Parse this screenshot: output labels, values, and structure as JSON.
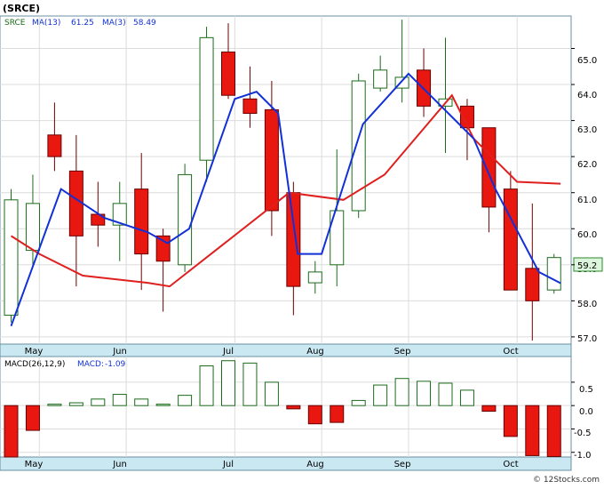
{
  "title": "(SRCE)",
  "copyright": "© 12Stocks.com",
  "colors": {
    "up_candle": "#1a6b1a",
    "down_candle": "#e8170f",
    "ma13": "#e01f1f",
    "ma3": "#1230d8",
    "axis_band": "#c9e8f2",
    "page_bg": "#ffffff",
    "last_price_box": "#2a8a2a"
  },
  "price_panel": {
    "legend": {
      "symbol": "SRCE",
      "ma13_label": "MA(13)",
      "ma13_value": "61.25",
      "ma3_label": "MA(3)",
      "ma3_value": "58.49"
    },
    "last_price": "59.2",
    "y_ticks": [
      "57.0",
      "58.0",
      "59.0",
      "60.0",
      "61.0",
      "62.0",
      "63.0",
      "64.0",
      "65.0"
    ]
  },
  "macd_panel": {
    "legend": {
      "label": "MACD(26,12,9)",
      "value_label": "MACD:",
      "value": "-1.09"
    },
    "y_ticks": [
      "0.5",
      "0.0",
      "-0.5",
      "-1.0"
    ]
  },
  "months": [
    "May",
    "Jun",
    "Jul",
    "Aug",
    "Sep",
    "Oct"
  ],
  "chart_data": [
    {
      "type": "candlestick",
      "title": "(SRCE)",
      "ylim": [
        56.8,
        65.9
      ],
      "y_ticks": [
        57,
        58,
        59,
        60,
        61,
        62,
        63,
        64,
        65
      ],
      "x_month_labels": [
        {
          "label": "May",
          "index": 1.3
        },
        {
          "label": "Jun",
          "index": 5.3
        },
        {
          "label": "Jul",
          "index": 10.3
        },
        {
          "label": "Aug",
          "index": 14.3
        },
        {
          "label": "Sep",
          "index": 18.3
        },
        {
          "label": "Oct",
          "index": 23.3
        }
      ],
      "candles": [
        {
          "o": 57.6,
          "h": 61.1,
          "l": 57.4,
          "c": 60.8
        },
        {
          "o": 59.4,
          "h": 61.5,
          "l": 59.0,
          "c": 60.7
        },
        {
          "o": 62.6,
          "h": 63.5,
          "l": 61.6,
          "c": 62.0
        },
        {
          "o": 61.6,
          "h": 62.6,
          "l": 58.4,
          "c": 59.8
        },
        {
          "o": 60.4,
          "h": 61.3,
          "l": 59.5,
          "c": 60.1
        },
        {
          "o": 60.1,
          "h": 61.3,
          "l": 59.1,
          "c": 60.7
        },
        {
          "o": 61.1,
          "h": 62.1,
          "l": 58.3,
          "c": 59.3
        },
        {
          "o": 59.8,
          "h": 60.0,
          "l": 57.7,
          "c": 59.1
        },
        {
          "o": 59.0,
          "h": 61.8,
          "l": 58.8,
          "c": 61.5
        },
        {
          "o": 61.9,
          "h": 65.6,
          "l": 61.3,
          "c": 65.3
        },
        {
          "o": 64.9,
          "h": 65.7,
          "l": 63.6,
          "c": 63.7
        },
        {
          "o": 63.6,
          "h": 64.5,
          "l": 62.8,
          "c": 63.2
        },
        {
          "o": 63.3,
          "h": 64.1,
          "l": 59.8,
          "c": 60.5
        },
        {
          "o": 61.0,
          "h": 61.3,
          "l": 57.6,
          "c": 58.4
        },
        {
          "o": 58.5,
          "h": 59.1,
          "l": 58.2,
          "c": 58.8
        },
        {
          "o": 59.0,
          "h": 62.2,
          "l": 58.4,
          "c": 60.5
        },
        {
          "o": 60.5,
          "h": 64.3,
          "l": 60.3,
          "c": 64.1
        },
        {
          "o": 63.9,
          "h": 64.8,
          "l": 63.8,
          "c": 64.4
        },
        {
          "o": 63.9,
          "h": 65.8,
          "l": 63.5,
          "c": 64.2
        },
        {
          "o": 64.4,
          "h": 65.0,
          "l": 63.1,
          "c": 63.4
        },
        {
          "o": 63.4,
          "h": 65.3,
          "l": 62.1,
          "c": 63.6
        },
        {
          "o": 63.4,
          "h": 63.6,
          "l": 61.9,
          "c": 62.8
        },
        {
          "o": 62.8,
          "h": 62.8,
          "l": 59.9,
          "c": 60.6
        },
        {
          "o": 61.1,
          "h": 61.6,
          "l": 58.3,
          "c": 58.3
        },
        {
          "o": 58.9,
          "h": 60.7,
          "l": 56.9,
          "c": 58.0
        },
        {
          "o": 58.3,
          "h": 59.3,
          "l": 58.2,
          "c": 59.2
        }
      ],
      "series": [
        {
          "name": "MA(13)",
          "points": [
            {
              "i": 0,
              "v": 59.8
            },
            {
              "i": 1.3,
              "v": 59.3
            },
            {
              "i": 3.3,
              "v": 58.7
            },
            {
              "i": 6.3,
              "v": 58.5
            },
            {
              "i": 7.3,
              "v": 58.4
            },
            {
              "i": 12.8,
              "v": 61.0
            },
            {
              "i": 15.3,
              "v": 60.8
            },
            {
              "i": 17.2,
              "v": 61.5
            },
            {
              "i": 20.3,
              "v": 63.7
            },
            {
              "i": 21.3,
              "v": 62.5
            },
            {
              "i": 23.3,
              "v": 61.3
            },
            {
              "i": 25.3,
              "v": 61.25
            }
          ]
        },
        {
          "name": "MA(3)",
          "points": [
            {
              "i": 0,
              "v": 57.3
            },
            {
              "i": 2.3,
              "v": 61.1
            },
            {
              "i": 4.3,
              "v": 60.3
            },
            {
              "i": 6.3,
              "v": 59.9
            },
            {
              "i": 7.2,
              "v": 59.6
            },
            {
              "i": 8.2,
              "v": 60.0
            },
            {
              "i": 10.3,
              "v": 63.6
            },
            {
              "i": 11.3,
              "v": 63.8
            },
            {
              "i": 12.3,
              "v": 63.2
            },
            {
              "i": 13.2,
              "v": 59.3
            },
            {
              "i": 14.3,
              "v": 59.3
            },
            {
              "i": 16.2,
              "v": 62.9
            },
            {
              "i": 18.3,
              "v": 64.3
            },
            {
              "i": 19.3,
              "v": 63.7
            },
            {
              "i": 21.3,
              "v": 62.5
            },
            {
              "i": 22.3,
              "v": 61.1
            },
            {
              "i": 24.3,
              "v": 58.8
            },
            {
              "i": 25.3,
              "v": 58.49
            }
          ]
        }
      ]
    },
    {
      "type": "bar",
      "title": "MACD(26,12,9)",
      "ylim": [
        -1.1,
        1.05
      ],
      "y_ticks": [
        0.5,
        0.0,
        -0.5,
        -1.0
      ],
      "values": [
        -1.1,
        -0.53,
        0.03,
        0.06,
        0.14,
        0.24,
        0.14,
        0.03,
        0.22,
        0.85,
        0.96,
        0.91,
        0.5,
        -0.07,
        -0.39,
        -0.36,
        0.11,
        0.44,
        0.58,
        0.52,
        0.48,
        0.33,
        -0.12,
        -0.66,
        -1.07,
        -1.09
      ]
    }
  ]
}
